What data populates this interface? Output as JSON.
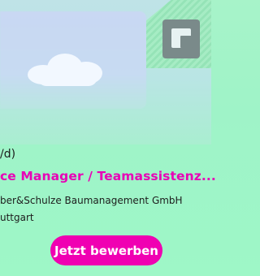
{
  "job_card": {
    "meta_top": "/d)",
    "title": "ce Manager / Teamassistenz...",
    "company": "ber&Schulze Baumanagement GmbH",
    "location": "uttgart",
    "apply_label": "Jetzt bewerben"
  },
  "icons": {
    "cloud": "cloud-icon",
    "expand": "expand-icon"
  },
  "colors": {
    "accent": "#e800b6",
    "button": "#f000b2",
    "background": "#a7f3c9"
  }
}
